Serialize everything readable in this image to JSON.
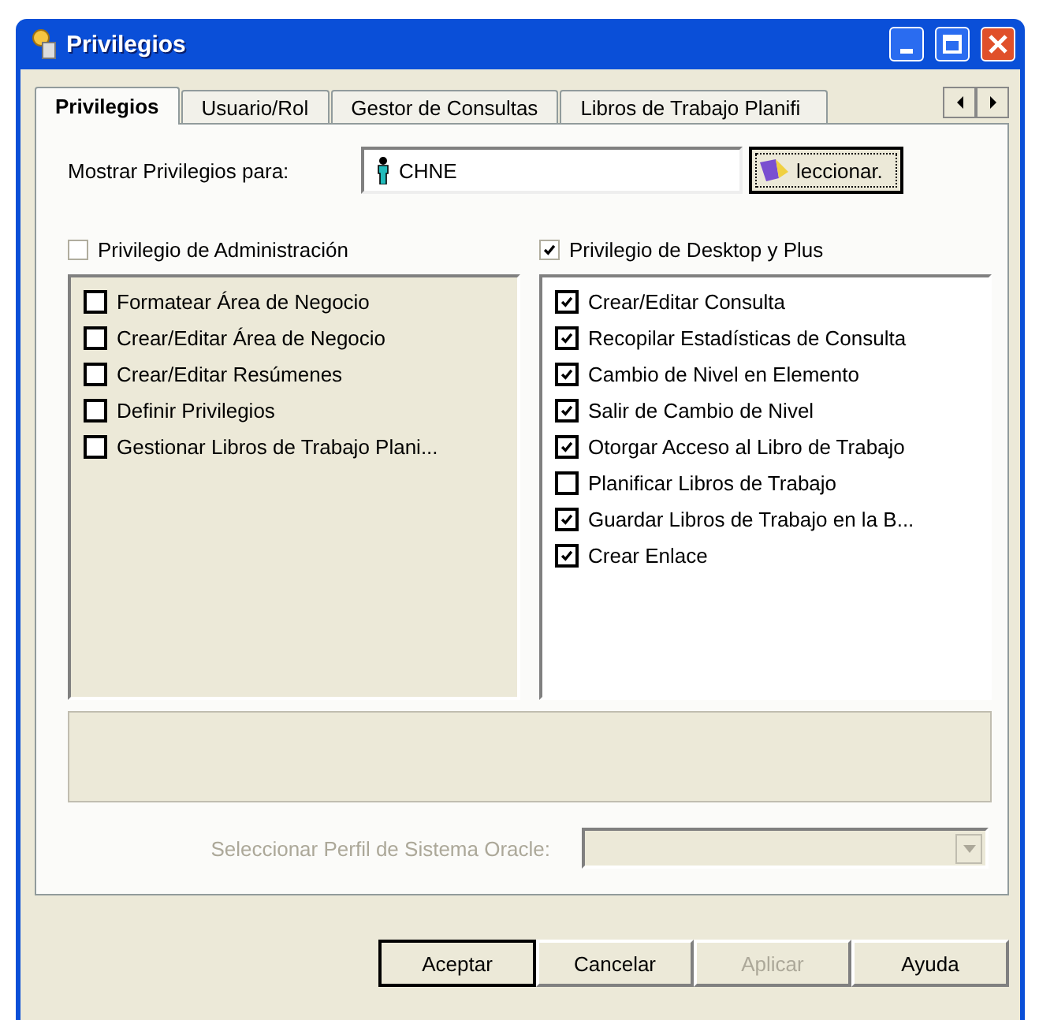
{
  "window": {
    "title": "Privilegios"
  },
  "tabs": [
    {
      "label": "Privilegios",
      "selected": true
    },
    {
      "label": "Usuario/Rol",
      "selected": false
    },
    {
      "label": "Gestor de Consultas",
      "selected": false
    },
    {
      "label": "Libros de Trabajo Planifi",
      "selected": false
    }
  ],
  "show_for": {
    "label": "Mostrar Privilegios para:",
    "value": "CHNE",
    "button": "leccionar."
  },
  "groups": [
    {
      "label": "Privilegio de Administración",
      "checked": false,
      "items": [
        {
          "label": "Formatear Área de Negocio",
          "checked": false
        },
        {
          "label": "Crear/Editar Área de Negocio",
          "checked": false
        },
        {
          "label": "Crear/Editar Resúmenes",
          "checked": false
        },
        {
          "label": "Definir Privilegios",
          "checked": false
        },
        {
          "label": "Gestionar Libros de Trabajo Plani...",
          "checked": false
        }
      ]
    },
    {
      "label": "Privilegio de Desktop y Plus",
      "checked": true,
      "items": [
        {
          "label": "Crear/Editar Consulta",
          "checked": true
        },
        {
          "label": "Recopilar Estadísticas de Consulta",
          "checked": true
        },
        {
          "label": "Cambio de Nivel en Elemento",
          "checked": true
        },
        {
          "label": "Salir de Cambio de Nivel",
          "checked": true
        },
        {
          "label": "Otorgar Acceso al Libro de Trabajo",
          "checked": true
        },
        {
          "label": "Planificar Libros de Trabajo",
          "checked": false
        },
        {
          "label": "Guardar Libros de Trabajo en la B...",
          "checked": true
        },
        {
          "label": "Crear Enlace",
          "checked": true
        }
      ]
    }
  ],
  "profile": {
    "label": "Seleccionar Perfil de Sistema Oracle:",
    "disabled": true
  },
  "buttons": [
    {
      "label": "Aceptar",
      "default": true,
      "disabled": false
    },
    {
      "label": "Cancelar",
      "default": false,
      "disabled": false
    },
    {
      "label": "Aplicar",
      "default": false,
      "disabled": true
    },
    {
      "label": "Ayuda",
      "default": false,
      "disabled": false
    }
  ]
}
